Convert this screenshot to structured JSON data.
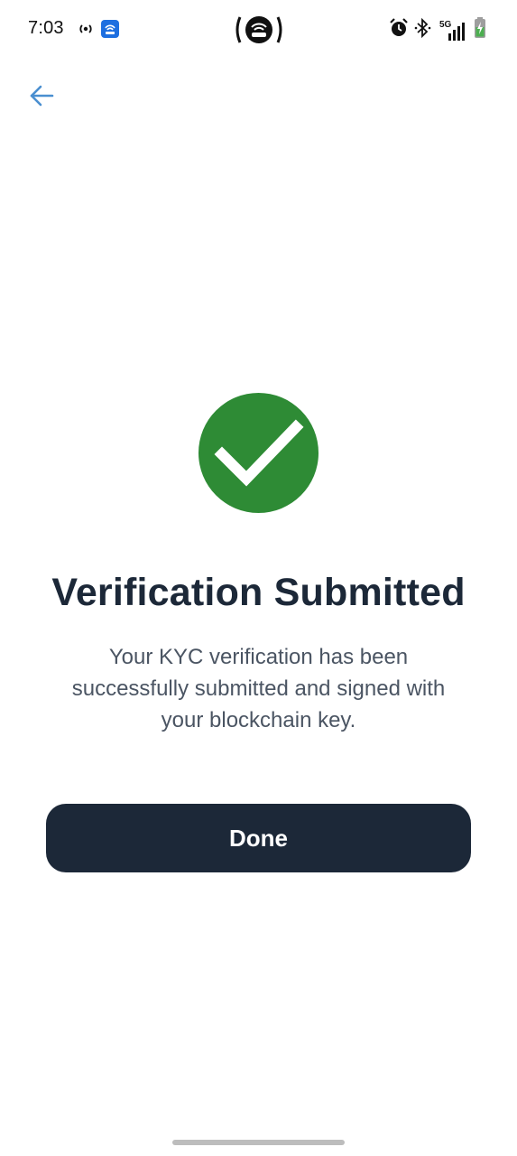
{
  "status_bar": {
    "time": "7:03",
    "network_label": "5G",
    "icons": [
      "hotspot-icon",
      "app-notification-icon",
      "cast-icon",
      "alarm-icon",
      "bluetooth-icon",
      "signal-icon",
      "battery-charging-icon"
    ]
  },
  "header": {
    "back_icon": "arrow-left-icon"
  },
  "main": {
    "status_icon": "check-circle-icon",
    "title": "Verification Submitted",
    "message": "Your KYC verification has been successfully submitted and signed with your blockchain key.",
    "done_label": "Done"
  },
  "colors": {
    "success": "#2e8b35",
    "primary_dark": "#1c2838",
    "back_arrow": "#4a8fd0",
    "body_text": "#4b5563"
  }
}
